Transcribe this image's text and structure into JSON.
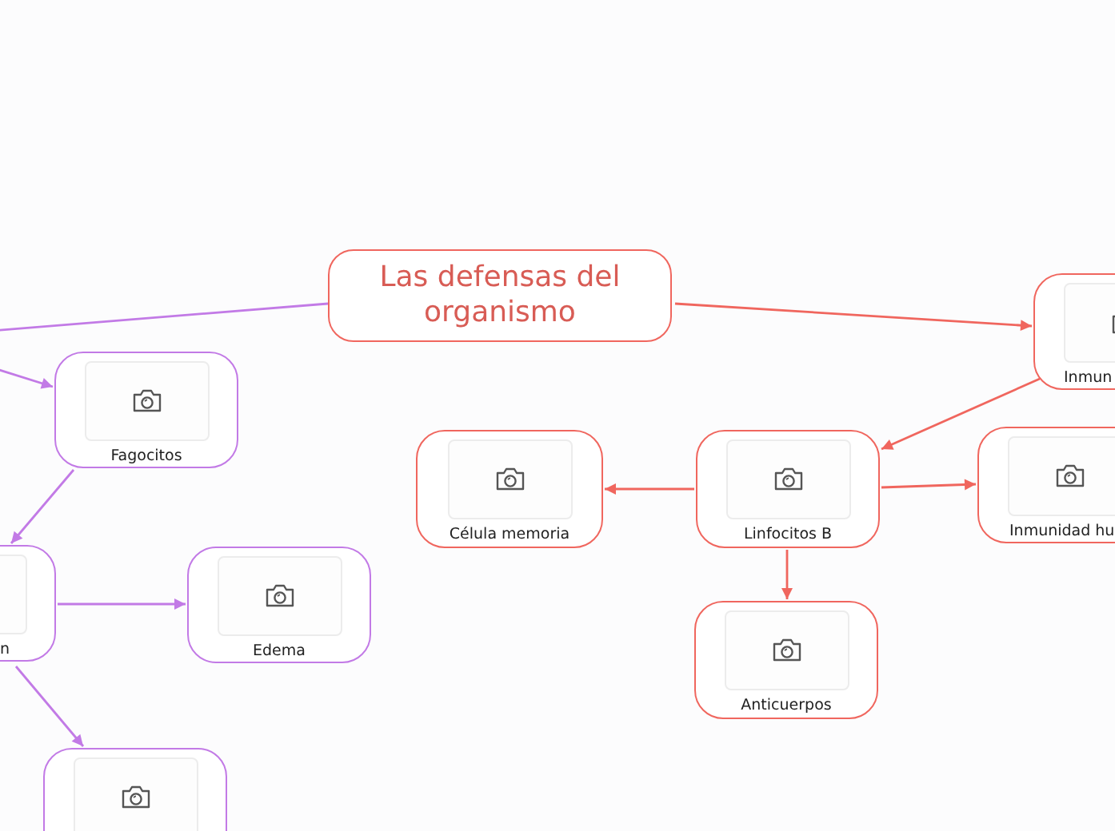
{
  "central": {
    "title": "Las defensas del organismo",
    "color": "#f0665e"
  },
  "nodes": [
    {
      "label": "Fagocitos",
      "color": "#c27ae6"
    },
    {
      "label": "Inmun",
      "color": "#f0665e"
    },
    {
      "label": "Célula memoria",
      "color": "#f0665e"
    },
    {
      "label": "Linfocitos B",
      "color": "#f0665e"
    },
    {
      "label": "Inmunidad hu",
      "color": "#f0665e"
    },
    {
      "label": "n",
      "color": "#c27ae6"
    },
    {
      "label": "Edema",
      "color": "#c27ae6"
    },
    {
      "label": "Anticuerpos",
      "color": "#f0665e"
    },
    {
      "color": "#c27ae6"
    }
  ]
}
